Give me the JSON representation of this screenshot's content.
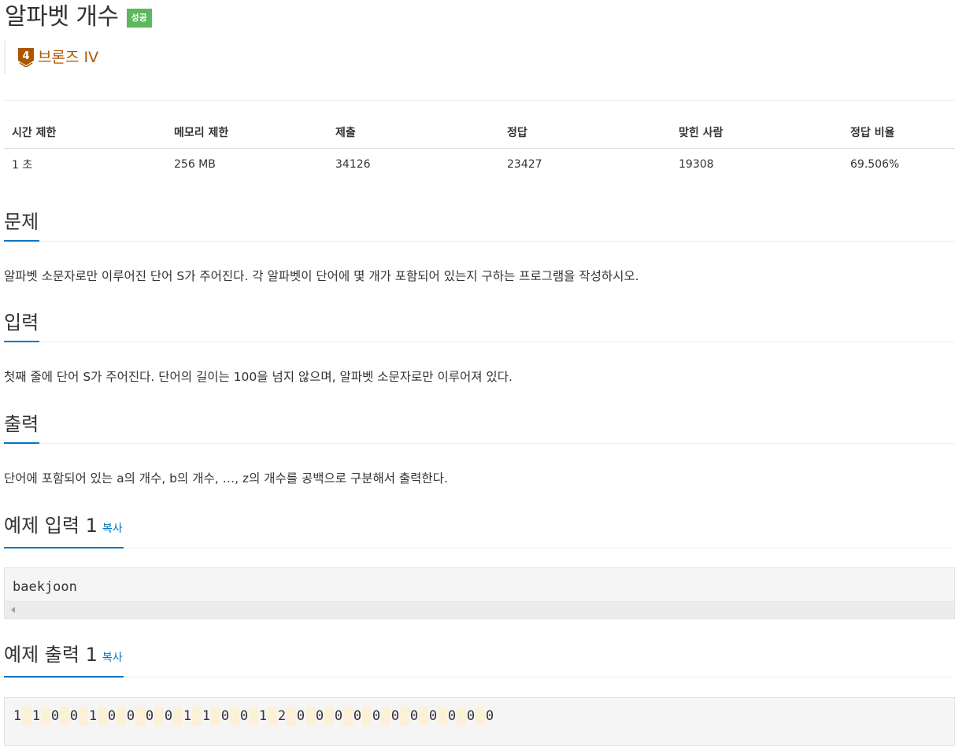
{
  "title": "알파벳 개수",
  "result_badge": "성공",
  "tier": {
    "level": "4",
    "label": "브론즈 IV",
    "color": "#ad5600"
  },
  "info_table": {
    "headers": [
      "시간 제한",
      "메모리 제한",
      "제출",
      "정답",
      "맞힌 사람",
      "정답 비율"
    ],
    "values": [
      "1 초",
      "256 MB",
      "34126",
      "23427",
      "19308",
      "69.506%"
    ]
  },
  "sections": {
    "problem": {
      "title": "문제",
      "text": "알파벳 소문자로만 이루어진 단어 S가 주어진다. 각 알파벳이 단어에 몇 개가 포함되어 있는지 구하는 프로그램을 작성하시오."
    },
    "input": {
      "title": "입력",
      "text": "첫째 줄에 단어 S가 주어진다. 단어의 길이는 100을 넘지 않으며, 알파벳 소문자로만 이루어져 있다."
    },
    "output": {
      "title": "출력",
      "text": "단어에 포함되어 있는 a의 개수, b의 개수, …, z의 개수를 공백으로 구분해서 출력한다."
    }
  },
  "sample_input": {
    "title": "예제 입력 1",
    "copy_label": "복사",
    "text": "baekjoon"
  },
  "sample_output": {
    "title": "예제 출력 1",
    "copy_label": "복사",
    "text": "1 1 0 0 1 0 0 0 0 1 1 0 0 1 2 0 0 0 0 0 0 0 0 0 0 0"
  },
  "colors": {
    "accent": "#0076c0",
    "success": "#5cb85c",
    "bronze": "#ad5600",
    "highlight": "#fcf1d6"
  }
}
